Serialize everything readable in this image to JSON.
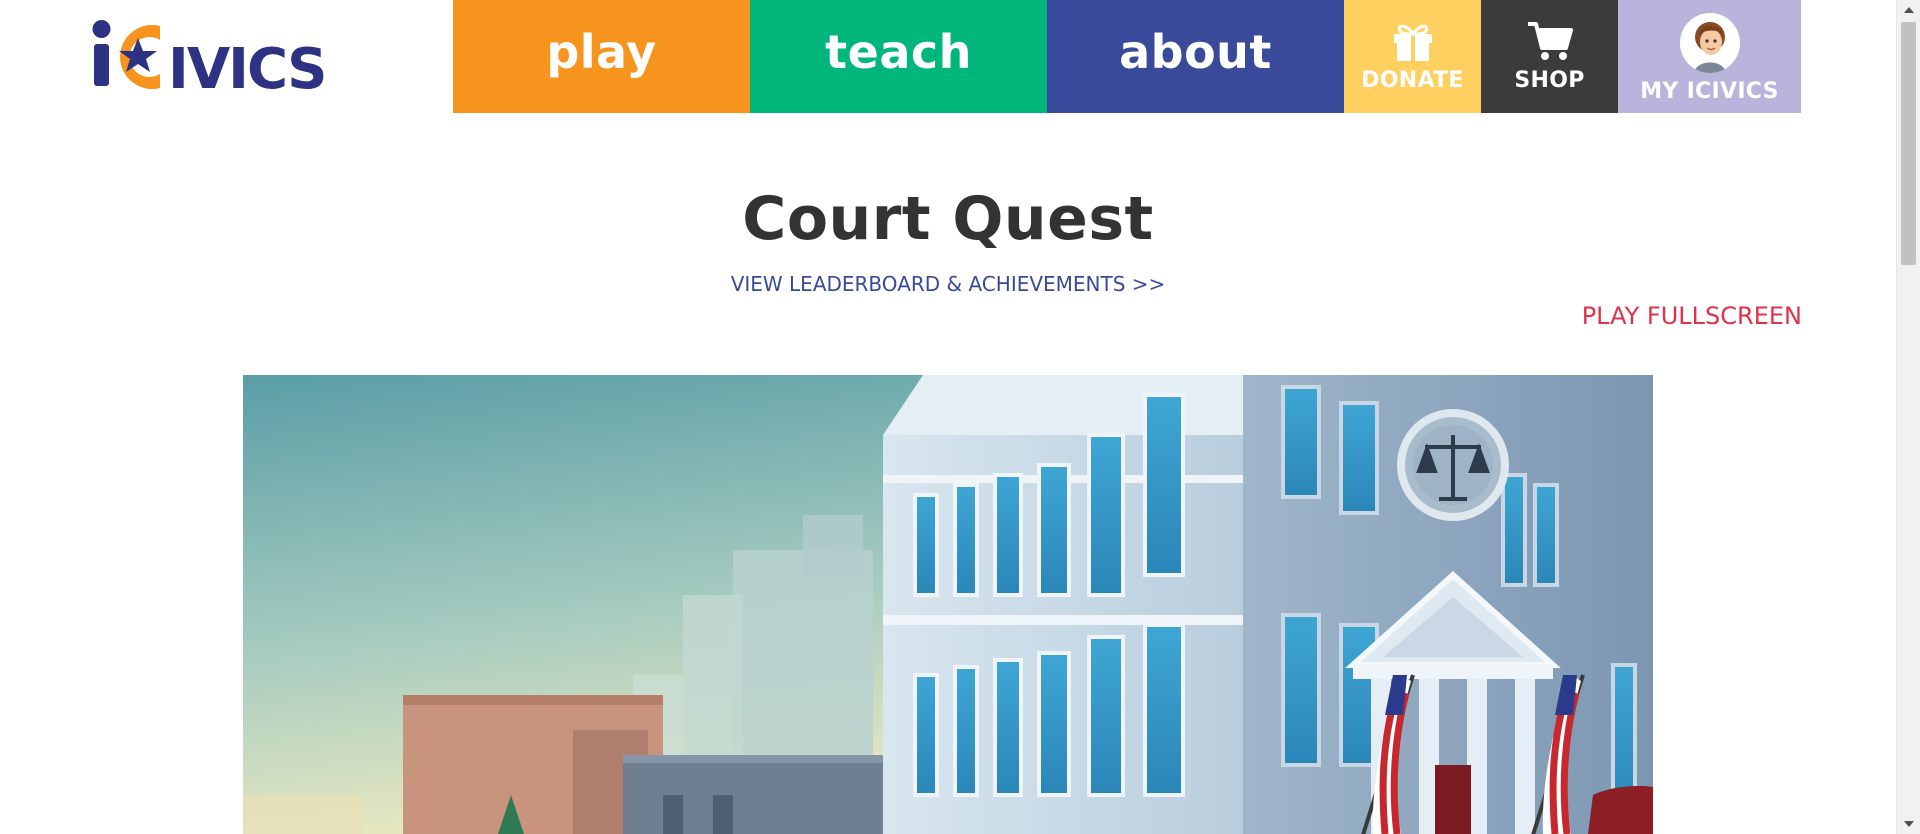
{
  "brand": {
    "name": "iCivics"
  },
  "nav": {
    "play": "play",
    "teach": "teach",
    "about": "about",
    "donate": "DONATE",
    "shop": "SHOP",
    "my_icivics": "MY ICIVICS"
  },
  "icons": {
    "donate": "gift-icon",
    "shop": "shopping-cart-icon",
    "profile": "avatar-icon",
    "scroll_up": "arrow-up-icon",
    "scroll_down": "arrow-down-icon"
  },
  "colors": {
    "play": "#f7941d",
    "teach": "#00b67a",
    "about": "#3a4a9a",
    "donate": "#ffd060",
    "shop": "#3b3b3b",
    "my_icivics": "#b8b4dc",
    "title": "#333333",
    "leaderboard_link": "#3a4a9a",
    "fullscreen_link": "#e0314b"
  },
  "page": {
    "title": "Court Quest",
    "leaderboard_link": "VIEW LEADERBOARD & ACHIEVEMENTS >>",
    "fullscreen_link": "PLAY FULLSCREEN"
  }
}
